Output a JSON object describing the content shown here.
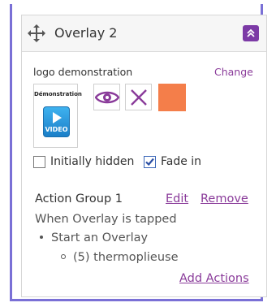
{
  "overlay": {
    "title": "Overlay 2",
    "logo_name": "logo demonstration",
    "change_label": "Change",
    "thumbnail": {
      "caption": "Démonstration",
      "badge": "VIDEO"
    },
    "swatch_color": "#f47e4a",
    "accent_color": "#7c3aa6",
    "link_color": "#8a3b9a"
  },
  "options": {
    "initially_hidden": {
      "label": "Initially hidden",
      "checked": false
    },
    "fade_in": {
      "label": "Fade in",
      "checked": true
    }
  },
  "action_group": {
    "title": "Action Group 1",
    "edit_label": "Edit",
    "remove_label": "Remove",
    "trigger": "When Overlay is tapped",
    "action": "Start an Overlay",
    "target": "(5) thermoplieuse",
    "add_actions_label": "Add Actions"
  }
}
